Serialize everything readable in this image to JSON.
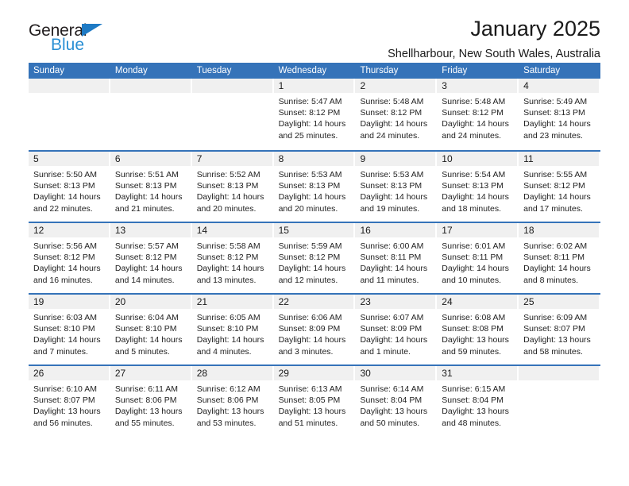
{
  "brand": {
    "name_top": "General",
    "name_bottom": "Blue",
    "accent_color": "#2a8fd4",
    "triangle_color": "#1e7ac4"
  },
  "header": {
    "title": "January 2025",
    "subtitle": "Shellharbour, New South Wales, Australia"
  },
  "theme": {
    "header_row_bg": "#3573b9",
    "header_row_text": "#ffffff",
    "daynum_band_bg": "#f0f0f0",
    "week_divider": "#3573b9",
    "body_text": "#222222"
  },
  "weekdays": [
    "Sunday",
    "Monday",
    "Tuesday",
    "Wednesday",
    "Thursday",
    "Friday",
    "Saturday"
  ],
  "calendar": {
    "month": "January",
    "year": "2025",
    "weeks": [
      [
        {
          "day": "",
          "empty": true,
          "lines": []
        },
        {
          "day": "",
          "empty": true,
          "lines": []
        },
        {
          "day": "",
          "empty": true,
          "lines": []
        },
        {
          "day": "1",
          "empty": false,
          "lines": [
            "Sunrise: 5:47 AM",
            "Sunset: 8:12 PM",
            "Daylight: 14 hours",
            "and 25 minutes."
          ]
        },
        {
          "day": "2",
          "empty": false,
          "lines": [
            "Sunrise: 5:48 AM",
            "Sunset: 8:12 PM",
            "Daylight: 14 hours",
            "and 24 minutes."
          ]
        },
        {
          "day": "3",
          "empty": false,
          "lines": [
            "Sunrise: 5:48 AM",
            "Sunset: 8:12 PM",
            "Daylight: 14 hours",
            "and 24 minutes."
          ]
        },
        {
          "day": "4",
          "empty": false,
          "lines": [
            "Sunrise: 5:49 AM",
            "Sunset: 8:13 PM",
            "Daylight: 14 hours",
            "and 23 minutes."
          ]
        }
      ],
      [
        {
          "day": "5",
          "empty": false,
          "lines": [
            "Sunrise: 5:50 AM",
            "Sunset: 8:13 PM",
            "Daylight: 14 hours",
            "and 22 minutes."
          ]
        },
        {
          "day": "6",
          "empty": false,
          "lines": [
            "Sunrise: 5:51 AM",
            "Sunset: 8:13 PM",
            "Daylight: 14 hours",
            "and 21 minutes."
          ]
        },
        {
          "day": "7",
          "empty": false,
          "lines": [
            "Sunrise: 5:52 AM",
            "Sunset: 8:13 PM",
            "Daylight: 14 hours",
            "and 20 minutes."
          ]
        },
        {
          "day": "8",
          "empty": false,
          "lines": [
            "Sunrise: 5:53 AM",
            "Sunset: 8:13 PM",
            "Daylight: 14 hours",
            "and 20 minutes."
          ]
        },
        {
          "day": "9",
          "empty": false,
          "lines": [
            "Sunrise: 5:53 AM",
            "Sunset: 8:13 PM",
            "Daylight: 14 hours",
            "and 19 minutes."
          ]
        },
        {
          "day": "10",
          "empty": false,
          "lines": [
            "Sunrise: 5:54 AM",
            "Sunset: 8:13 PM",
            "Daylight: 14 hours",
            "and 18 minutes."
          ]
        },
        {
          "day": "11",
          "empty": false,
          "lines": [
            "Sunrise: 5:55 AM",
            "Sunset: 8:12 PM",
            "Daylight: 14 hours",
            "and 17 minutes."
          ]
        }
      ],
      [
        {
          "day": "12",
          "empty": false,
          "lines": [
            "Sunrise: 5:56 AM",
            "Sunset: 8:12 PM",
            "Daylight: 14 hours",
            "and 16 minutes."
          ]
        },
        {
          "day": "13",
          "empty": false,
          "lines": [
            "Sunrise: 5:57 AM",
            "Sunset: 8:12 PM",
            "Daylight: 14 hours",
            "and 14 minutes."
          ]
        },
        {
          "day": "14",
          "empty": false,
          "lines": [
            "Sunrise: 5:58 AM",
            "Sunset: 8:12 PM",
            "Daylight: 14 hours",
            "and 13 minutes."
          ]
        },
        {
          "day": "15",
          "empty": false,
          "lines": [
            "Sunrise: 5:59 AM",
            "Sunset: 8:12 PM",
            "Daylight: 14 hours",
            "and 12 minutes."
          ]
        },
        {
          "day": "16",
          "empty": false,
          "lines": [
            "Sunrise: 6:00 AM",
            "Sunset: 8:11 PM",
            "Daylight: 14 hours",
            "and 11 minutes."
          ]
        },
        {
          "day": "17",
          "empty": false,
          "lines": [
            "Sunrise: 6:01 AM",
            "Sunset: 8:11 PM",
            "Daylight: 14 hours",
            "and 10 minutes."
          ]
        },
        {
          "day": "18",
          "empty": false,
          "lines": [
            "Sunrise: 6:02 AM",
            "Sunset: 8:11 PM",
            "Daylight: 14 hours",
            "and 8 minutes."
          ]
        }
      ],
      [
        {
          "day": "19",
          "empty": false,
          "lines": [
            "Sunrise: 6:03 AM",
            "Sunset: 8:10 PM",
            "Daylight: 14 hours",
            "and 7 minutes."
          ]
        },
        {
          "day": "20",
          "empty": false,
          "lines": [
            "Sunrise: 6:04 AM",
            "Sunset: 8:10 PM",
            "Daylight: 14 hours",
            "and 5 minutes."
          ]
        },
        {
          "day": "21",
          "empty": false,
          "lines": [
            "Sunrise: 6:05 AM",
            "Sunset: 8:10 PM",
            "Daylight: 14 hours",
            "and 4 minutes."
          ]
        },
        {
          "day": "22",
          "empty": false,
          "lines": [
            "Sunrise: 6:06 AM",
            "Sunset: 8:09 PM",
            "Daylight: 14 hours",
            "and 3 minutes."
          ]
        },
        {
          "day": "23",
          "empty": false,
          "lines": [
            "Sunrise: 6:07 AM",
            "Sunset: 8:09 PM",
            "Daylight: 14 hours",
            "and 1 minute."
          ]
        },
        {
          "day": "24",
          "empty": false,
          "lines": [
            "Sunrise: 6:08 AM",
            "Sunset: 8:08 PM",
            "Daylight: 13 hours",
            "and 59 minutes."
          ]
        },
        {
          "day": "25",
          "empty": false,
          "lines": [
            "Sunrise: 6:09 AM",
            "Sunset: 8:07 PM",
            "Daylight: 13 hours",
            "and 58 minutes."
          ]
        }
      ],
      [
        {
          "day": "26",
          "empty": false,
          "lines": [
            "Sunrise: 6:10 AM",
            "Sunset: 8:07 PM",
            "Daylight: 13 hours",
            "and 56 minutes."
          ]
        },
        {
          "day": "27",
          "empty": false,
          "lines": [
            "Sunrise: 6:11 AM",
            "Sunset: 8:06 PM",
            "Daylight: 13 hours",
            "and 55 minutes."
          ]
        },
        {
          "day": "28",
          "empty": false,
          "lines": [
            "Sunrise: 6:12 AM",
            "Sunset: 8:06 PM",
            "Daylight: 13 hours",
            "and 53 minutes."
          ]
        },
        {
          "day": "29",
          "empty": false,
          "lines": [
            "Sunrise: 6:13 AM",
            "Sunset: 8:05 PM",
            "Daylight: 13 hours",
            "and 51 minutes."
          ]
        },
        {
          "day": "30",
          "empty": false,
          "lines": [
            "Sunrise: 6:14 AM",
            "Sunset: 8:04 PM",
            "Daylight: 13 hours",
            "and 50 minutes."
          ]
        },
        {
          "day": "31",
          "empty": false,
          "lines": [
            "Sunrise: 6:15 AM",
            "Sunset: 8:04 PM",
            "Daylight: 13 hours",
            "and 48 minutes."
          ]
        },
        {
          "day": "",
          "empty": true,
          "lines": []
        }
      ]
    ]
  }
}
